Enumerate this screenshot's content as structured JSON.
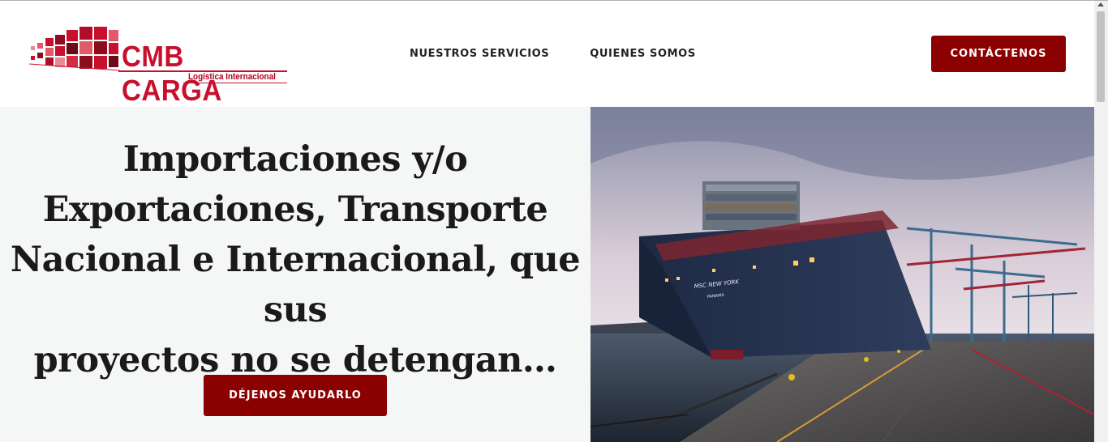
{
  "header": {
    "logo": {
      "name": "CMB CARGA",
      "tagline": "Logística Internacional"
    },
    "nav": [
      {
        "label": "NUESTROS SERVICIOS"
      },
      {
        "label": "QUIENES SOMOS"
      }
    ],
    "contact_label": "CONTÁCTENOS"
  },
  "hero": {
    "title_lines": [
      "Importaciones y/o",
      "Exportaciones, Transporte",
      "Nacional e Internacional, que sus",
      "proyectos no se detengan…"
    ],
    "cta_label": "DÉJENOS AYUDARLO",
    "image": {
      "ship_name": "MSC NEW YORK",
      "ship_port": "PANAMA"
    }
  },
  "colors": {
    "brand_red": "#c8102e",
    "button_bg": "#8b0000",
    "hero_bg": "#f5f6f6"
  }
}
